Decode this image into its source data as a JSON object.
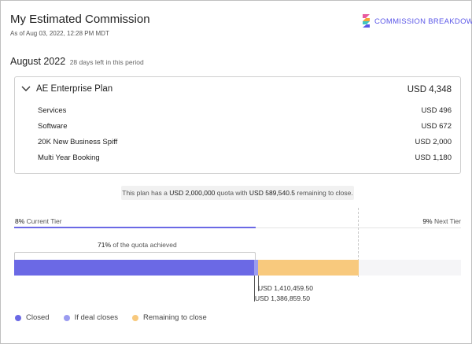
{
  "header": {
    "title": "My Estimated Commission",
    "as_of": "As of Aug 03, 2022, 12:28 PM MDT",
    "link_label": "COMMISSION BREAKDOWN",
    "logo_icon": "stacked-s-logo-icon"
  },
  "period": {
    "name": "August 2022",
    "days_left": "28 days left in this period"
  },
  "plan": {
    "name": "AE Enterprise Plan",
    "total": "USD 4,348",
    "expand_icon": "chevron-down-icon",
    "rows": [
      {
        "label": "Services",
        "value": "USD 496"
      },
      {
        "label": "Software",
        "value": "USD 672"
      },
      {
        "label": "20K New Business Spiff",
        "value": "USD 2,000"
      },
      {
        "label": "Multi Year Booking",
        "value": "USD 1,180"
      }
    ]
  },
  "quota_note": {
    "prefix": "This plan has a",
    "quota": "USD 2,000,000",
    "middle": "quota with",
    "remaining": "USD 589,540.5",
    "suffix": "remaining to close."
  },
  "tiers": {
    "current_pct": "8%",
    "current_label": "Current Tier",
    "next_pct": "9%",
    "next_label": "Next Tier",
    "current_progress": 0.54
  },
  "progress": {
    "achieved_pct": "71%",
    "achieved_label": "of the quota achieved",
    "value_deal": "USD 1,410,459.50",
    "value_closed": "USD 1,386,859.50",
    "closed_fraction": 0.5371,
    "if_deal_fraction": 0.5465,
    "remaining_fraction": 0.7711
  },
  "legend": [
    {
      "label": "Closed",
      "color": "#6b69e5"
    },
    {
      "label": "If deal closes",
      "color": "#9b9cf0"
    },
    {
      "label": "Remaining to close",
      "color": "#f8c97d"
    }
  ]
}
